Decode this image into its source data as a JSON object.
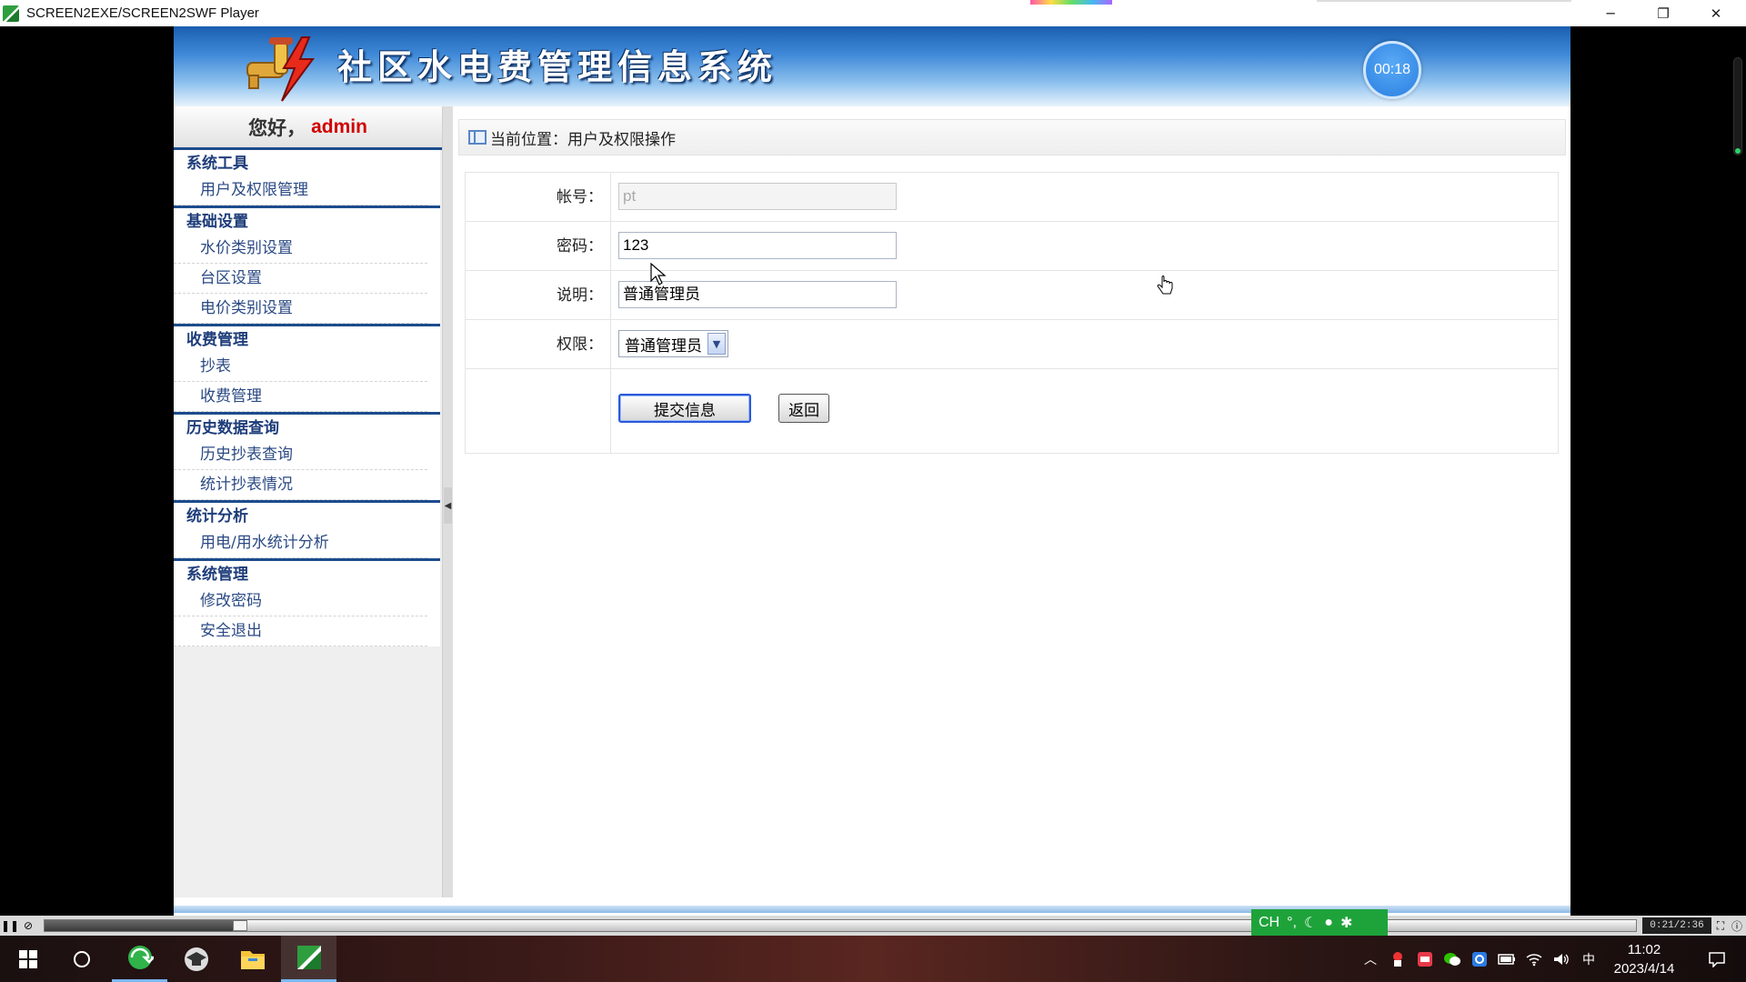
{
  "window": {
    "title": "SCREEN2EXE/SCREEN2SWF Player",
    "minimize_glyph": "─",
    "restore_glyph": "❐",
    "close_glyph": "✕"
  },
  "banner": {
    "system_title": "社区水电费管理信息系统",
    "timer": "00:18"
  },
  "sidebar": {
    "greeting": "您好，",
    "username": "admin",
    "groups": [
      {
        "title": "系统工具",
        "items": [
          "用户及权限管理"
        ]
      },
      {
        "title": "基础设置",
        "items": [
          "水价类别设置",
          "台区设置",
          "电价类别设置"
        ]
      },
      {
        "title": "收费管理",
        "items": [
          "抄表",
          "收费管理"
        ]
      },
      {
        "title": "历史数据查询",
        "items": [
          "历史抄表查询",
          "统计抄表情况"
        ]
      },
      {
        "title": "统计分析",
        "items": [
          "用电/用水统计分析"
        ]
      },
      {
        "title": "系统管理",
        "items": [
          "修改密码",
          "安全退出"
        ]
      }
    ]
  },
  "breadcrumb": {
    "prefix": "当前位置：",
    "location": "用户及权限操作"
  },
  "form": {
    "account_label": "帐号：",
    "account_value": "pt",
    "password_label": "密码：",
    "password_value": "123",
    "desc_label": "说明：",
    "desc_value": "普通管理员",
    "role_label": "权限：",
    "role_selected": "普通管理员",
    "submit_label": "提交信息",
    "back_label": "返回"
  },
  "player": {
    "time": "0:21/2:36",
    "progress": 0.118
  },
  "ime": {
    "lang": "CH",
    "punct": "°,"
  },
  "taskbar": {
    "ime_lang": "中",
    "time": "11:02",
    "date": "2023/4/14"
  }
}
